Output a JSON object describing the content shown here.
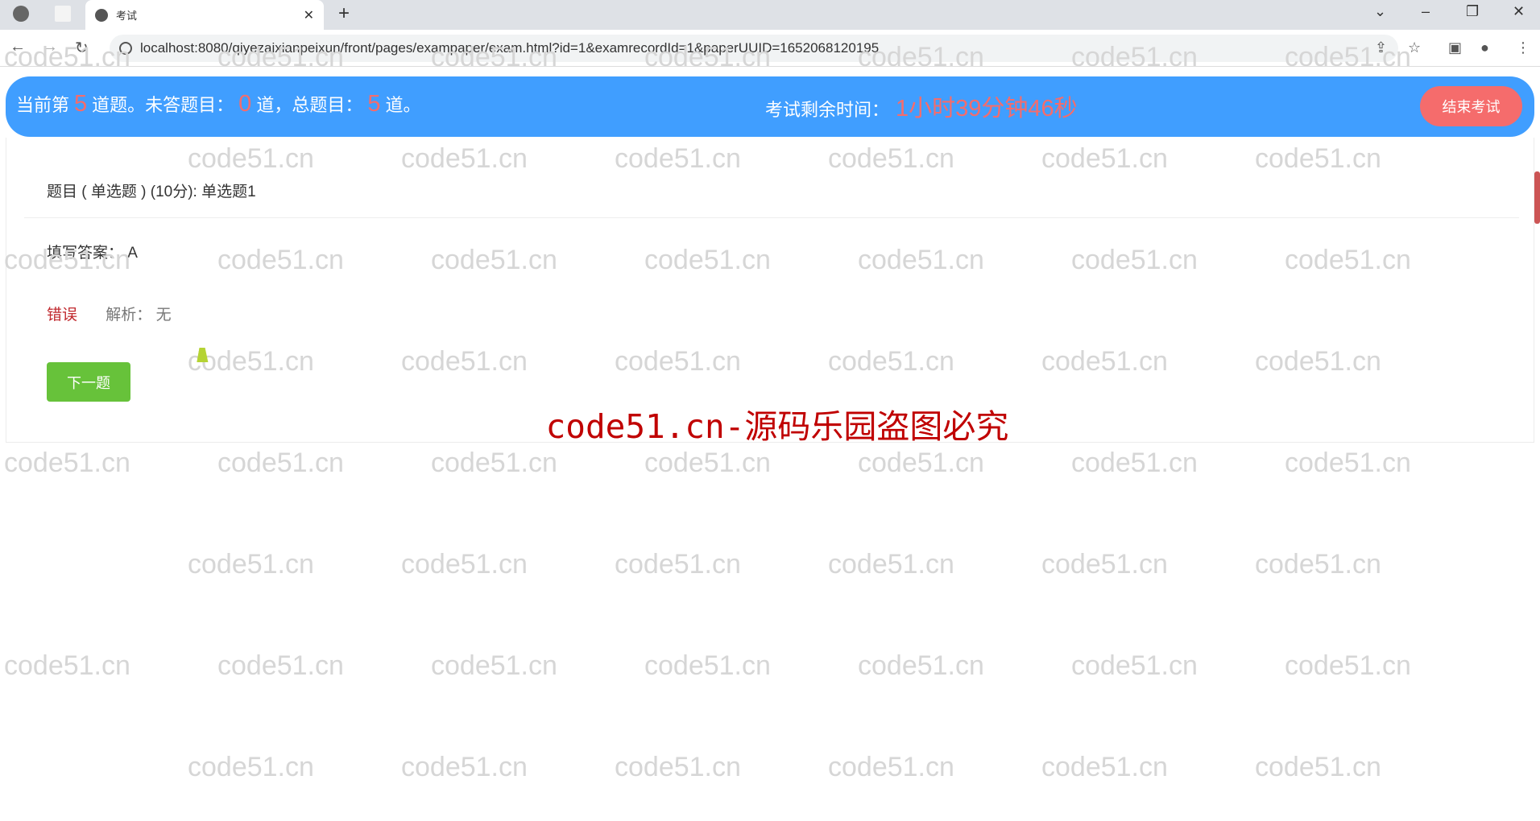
{
  "browser": {
    "tab_title": "考试",
    "url": "localhost:8080/qiyezaixianpeixun/front/pages/exampaper/exam.html?id=1&examrecordId=1&paperUUID=1652068120195"
  },
  "header": {
    "prefix": "当前第",
    "current": "5",
    "mid1": "道题。未答题目：",
    "unanswered": "0",
    "mid2": "道，总题目：",
    "total": "5",
    "suffix": "道。",
    "timer_label": "考试剩余时间：",
    "timer_value": "1小时39分钟46秒",
    "end_button": "结束考试"
  },
  "question": {
    "title": "题目 ( 单选题 ) (10分):   单选题1",
    "answer": "填写答案：  A",
    "result": "错误",
    "analysis": "解析：  无",
    "next_button": "下一题"
  },
  "watermark": {
    "tile": "code51.cn",
    "banner": "code51.cn-源码乐园盗图必究"
  },
  "colors": {
    "header_bg": "#409eff",
    "accent_red": "#f56c6c",
    "next_green": "#67c23a",
    "wrong_red": "#c0282d"
  }
}
